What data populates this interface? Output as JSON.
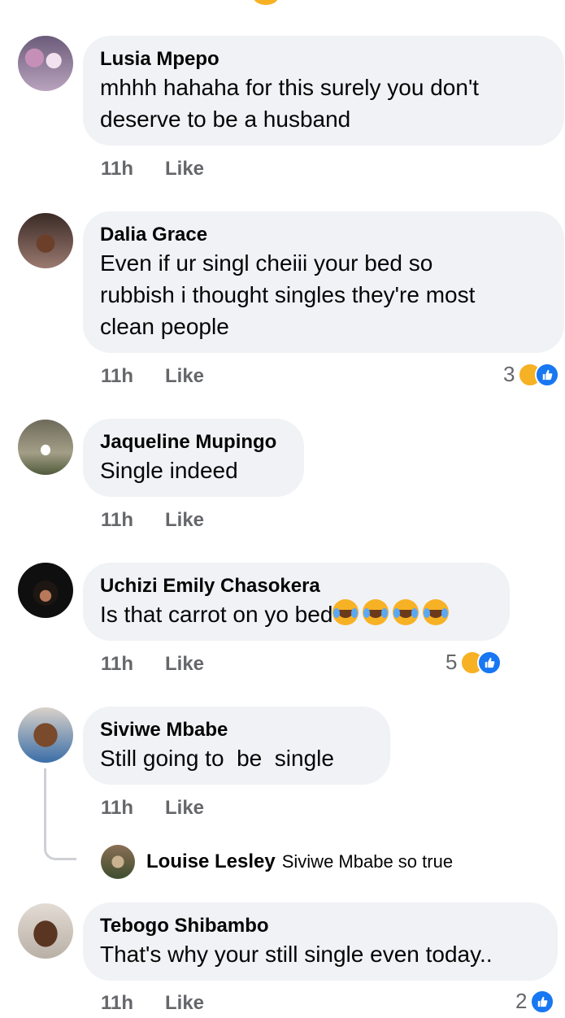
{
  "comments": [
    {
      "name": "Lusia Mpepo",
      "text": "mhhh hahaha for this surely you don't\ndeserve to be a husband",
      "time": "11h",
      "like": "Like"
    },
    {
      "name": "Dalia Grace",
      "text": "Even if ur singl cheiii your bed so\nrubbish i thought singles they're most\nclean people",
      "time": "11h",
      "like": "Like",
      "reactions": "3"
    },
    {
      "name": "Jaqueline Mupingo",
      "text": "Single indeed",
      "time": "11h",
      "like": "Like"
    },
    {
      "name": "Uchizi Emily Chasokera",
      "text": "Is that carrot on yo bed",
      "time": "11h",
      "like": "Like",
      "reactions": "5"
    },
    {
      "name": "Siviwe Mbabe",
      "text": "Still going to  be  single",
      "time": "11h",
      "like": "Like",
      "reply": {
        "name": "Louise Lesley",
        "text": "Siviwe Mbabe so true"
      }
    },
    {
      "name": "Tebogo Shibambo",
      "text": "That's why your still single even today..",
      "time": "11h",
      "like": "Like",
      "reactions": "2"
    }
  ],
  "colors": {
    "bubble": "#f0f2f5",
    "meta": "#65676b",
    "like_blue": "#1877f2",
    "haha": "#f7b125"
  }
}
